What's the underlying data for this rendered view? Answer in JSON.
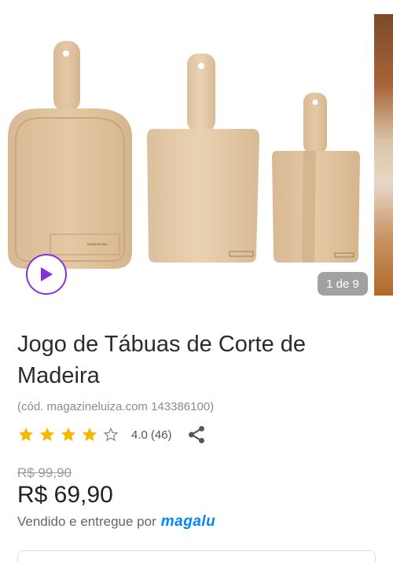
{
  "gallery": {
    "counter": "1 de 9",
    "board_brand": "TRAMONTINA",
    "image_desc_icon": "cutting-boards-image"
  },
  "product": {
    "title": "Jogo de Tábuas de Corte de Madeira",
    "code": "(cód. magazineluiza.com 143386100)",
    "rating_score": "4.0",
    "rating_count": "(46)",
    "stars_filled": 4,
    "stars_total": 5,
    "old_price": "R$ 99,90",
    "price": "R$ 69,90",
    "seller_prefix": "Vendido e entregue por",
    "seller_brand": "magalu"
  },
  "colors": {
    "star": "#f5b800",
    "play": "#8a2ee0",
    "brand": "#0086ff"
  }
}
